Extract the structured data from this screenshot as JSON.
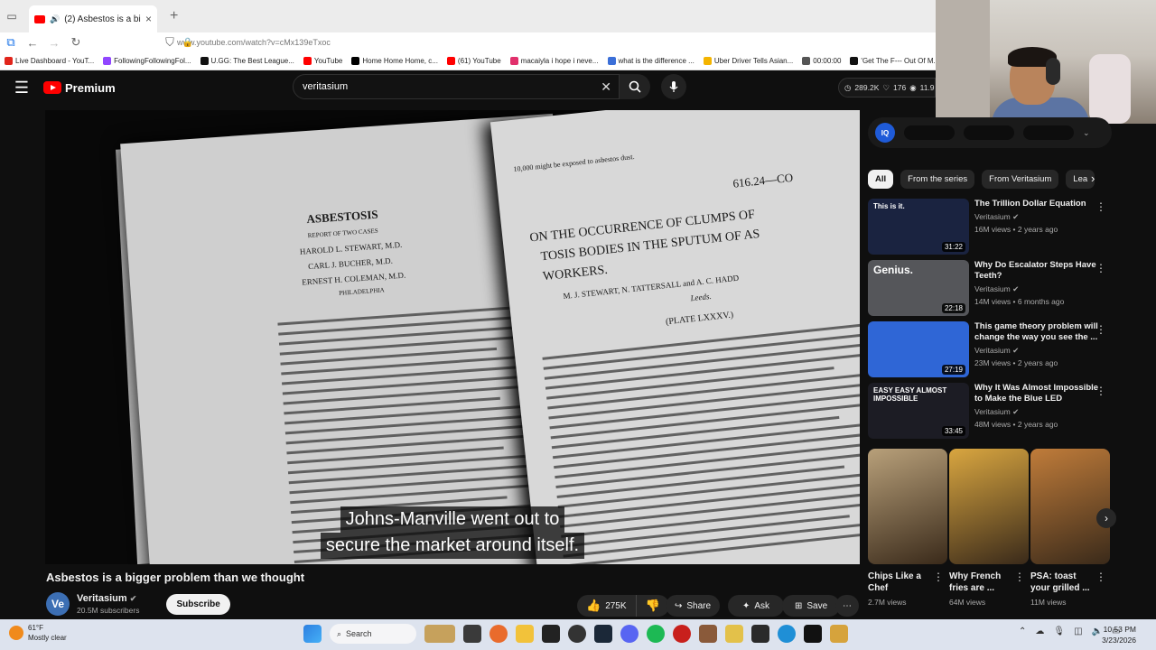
{
  "browser": {
    "tab_title": "(2) Asbestos is a bigger pro",
    "tab_close": "×",
    "new_tab": "+",
    "url": "www.youtube.com/watch?v=cMx139eTxoc",
    "bookmarks": [
      {
        "label": "Live Dashboard - YouT...",
        "color": "#e1251b"
      },
      {
        "label": "FollowingFollowingFol...",
        "color": "#9146ff"
      },
      {
        "label": "U.GG: The Best League...",
        "color": "#111111"
      },
      {
        "label": "YouTube",
        "color": "#ff0000"
      },
      {
        "label": "Home Home Home, c...",
        "color": "#000000"
      },
      {
        "label": "(61) YouTube",
        "color": "#ff0000"
      },
      {
        "label": "macaiyla i hope i neve...",
        "color": "#e1306c"
      },
      {
        "label": "what is the difference ...",
        "color": "#3b6fd8"
      },
      {
        "label": "Uber Driver Tells Asian...",
        "color": "#f4b400"
      },
      {
        "label": "00:00:00",
        "color": "#555555"
      },
      {
        "label": "'Get The F--- Out Of M...",
        "color": "#111111"
      }
    ]
  },
  "header": {
    "premium_label": "Premium",
    "search_value": "veritasium",
    "clear_glyph": "✕",
    "stats": {
      "views": "289.2K",
      "likes": "176",
      "other": "11.9"
    }
  },
  "video": {
    "caption_line1": "Johns-Manville went out to",
    "caption_line2": "secure the market around itself.",
    "doc_left": {
      "heading": "ASBESTOSIS",
      "subheading": "REPORT OF TWO CASES",
      "authors": [
        "HAROLD L. STEWART, M.D.",
        "CARL J. BUCHER, M.D.",
        "ERNEST H. COLEMAN, M.D."
      ],
      "city": "PHILADELPHIA"
    },
    "doc_right": {
      "code": "616.24—CO",
      "title1": "ON THE OCCURRENCE OF CLUMPS OF",
      "title2": "TOSIS BODIES IN THE SPUTUM OF AS",
      "title3": "WORKERS.",
      "authors": "M. J. STEWART, N. TATTERSALL and A. C. HADD",
      "place": "Leeds.",
      "plate": "(PLATE LXXXV.)",
      "top_line": "10,000 might be exposed to asbestos dust."
    }
  },
  "meta": {
    "title": "Asbestos is a bigger problem than we thought",
    "channel_initials": "Ve",
    "channel": "Veritasium",
    "subscribers": "20.5M subscribers",
    "subscribe": "Subscribe",
    "likes": "275K",
    "share": "Share",
    "ask": "Ask",
    "save": "Save"
  },
  "sidebar": {
    "iq_label": "IQ",
    "chips": [
      "All",
      "From the series",
      "From Veritasium",
      "Lea"
    ],
    "recommendations": [
      {
        "title": "The Trillion Dollar Equation",
        "channel": "Veritasium",
        "meta": "16M views • 2 years ago",
        "duration": "31:22",
        "overlay": "This is it.",
        "thumb_color": "#1a2340"
      },
      {
        "title": "Why Do Escalator Steps Have Teeth?",
        "channel": "Veritasium",
        "meta": "14M views • 6 months ago",
        "duration": "22:18",
        "overlay": "Genius.",
        "thumb_color": "#55565a"
      },
      {
        "title": "This game theory problem will change the way you see the ...",
        "channel": "Veritasium",
        "meta": "23M views • 2 years ago",
        "duration": "27:19",
        "overlay": "",
        "thumb_color": "#2f66d6"
      },
      {
        "title": "Why It Was Almost Impossible to Make the Blue LED",
        "channel": "Veritasium",
        "meta": "48M views • 2 years ago",
        "duration": "33:45",
        "overlay": "EASY  EASY  ALMOST IMPOSSIBLE",
        "thumb_color": "#1c1c24"
      }
    ],
    "shorts": [
      {
        "title": "Chips Like a Chef",
        "views": "2.7M views",
        "color": "#b8a07a"
      },
      {
        "title": "Why French fries are ...",
        "views": "64M views",
        "color": "#d9a640"
      },
      {
        "title": "PSA: toast your grilled ...",
        "views": "11M views",
        "color": "#c07c3a"
      }
    ]
  },
  "taskbar": {
    "temp": "61°F",
    "weather": "Mostly clear",
    "search": "Search",
    "time": "10:53 PM",
    "date": "3/23/2026"
  }
}
